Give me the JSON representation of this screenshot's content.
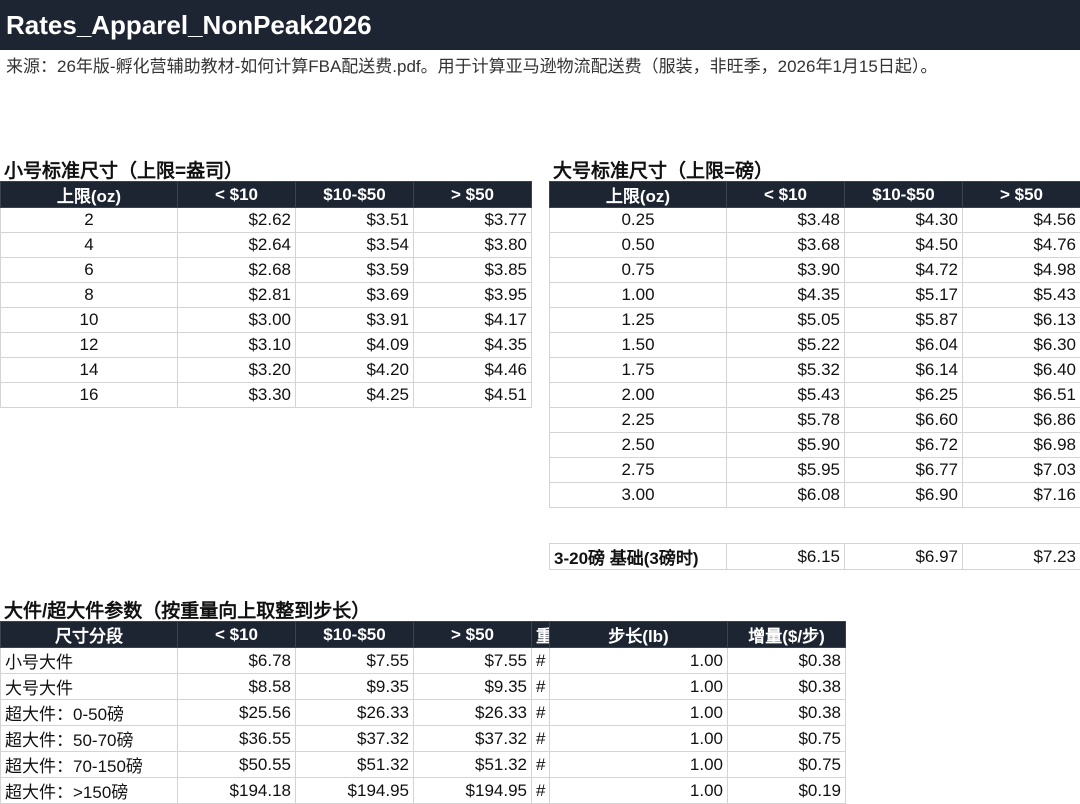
{
  "title": "Rates_Apparel_NonPeak2026",
  "source": "来源：26年版-孵化营辅助教材-如何计算FBA配送费.pdf。用于计算亚马逊物流配送费（服装，非旺季，2026年1月15日起）。",
  "small_standard": {
    "title": "小号标准尺寸（上限=盎司）",
    "headers": [
      "上限(oz)",
      "< $10",
      "$10-$50",
      "> $50"
    ],
    "rows": [
      [
        "2",
        "$2.62",
        "$3.51",
        "$3.77"
      ],
      [
        "4",
        "$2.64",
        "$3.54",
        "$3.80"
      ],
      [
        "6",
        "$2.68",
        "$3.59",
        "$3.85"
      ],
      [
        "8",
        "$2.81",
        "$3.69",
        "$3.95"
      ],
      [
        "10",
        "$3.00",
        "$3.91",
        "$4.17"
      ],
      [
        "12",
        "$3.10",
        "$4.09",
        "$4.35"
      ],
      [
        "14",
        "$3.20",
        "$4.20",
        "$4.46"
      ],
      [
        "16",
        "$3.30",
        "$4.25",
        "$4.51"
      ]
    ]
  },
  "large_standard": {
    "title": "大号标准尺寸（上限=磅）",
    "headers": [
      "上限(oz)",
      "< $10",
      "$10-$50",
      "> $50"
    ],
    "rows": [
      [
        "0.25",
        "$3.48",
        "$4.30",
        "$4.56"
      ],
      [
        "0.50",
        "$3.68",
        "$4.50",
        "$4.76"
      ],
      [
        "0.75",
        "$3.90",
        "$4.72",
        "$4.98"
      ],
      [
        "1.00",
        "$4.35",
        "$5.17",
        "$5.43"
      ],
      [
        "1.25",
        "$5.05",
        "$5.87",
        "$6.13"
      ],
      [
        "1.50",
        "$5.22",
        "$6.04",
        "$6.30"
      ],
      [
        "1.75",
        "$5.32",
        "$6.14",
        "$6.40"
      ],
      [
        "2.00",
        "$5.43",
        "$6.25",
        "$6.51"
      ],
      [
        "2.25",
        "$5.78",
        "$6.60",
        "$6.86"
      ],
      [
        "2.50",
        "$5.90",
        "$6.72",
        "$6.98"
      ],
      [
        "2.75",
        "$5.95",
        "$6.77",
        "$7.03"
      ],
      [
        "3.00",
        "$6.08",
        "$6.90",
        "$7.16"
      ]
    ],
    "base_row": [
      "3-20磅 基础(3磅时)",
      "$6.15",
      "$6.97",
      "$7.23"
    ]
  },
  "oversize": {
    "title": "大件/超大件参数（按重量向上取整到步长）",
    "headers": [
      "尺寸分段",
      "< $10",
      "$10-$50",
      "> $50",
      "重",
      "步长(lb)",
      "增量($/步)"
    ],
    "rows": [
      [
        "小号大件",
        "$6.78",
        "$7.55",
        "$7.55",
        "#",
        "1.00",
        "$0.38"
      ],
      [
        "大号大件",
        "$8.58",
        "$9.35",
        "$9.35",
        "#",
        "1.00",
        "$0.38"
      ],
      [
        "超大件：0-50磅",
        "$25.56",
        "$26.33",
        "$26.33",
        "#",
        "1.00",
        "$0.38"
      ],
      [
        "超大件：50-70磅",
        "$36.55",
        "$37.32",
        "$37.32",
        "#",
        "1.00",
        "$0.75"
      ],
      [
        "超大件：70-150磅",
        "$50.55",
        "$51.32",
        "$51.32",
        "#",
        "1.00",
        "$0.75"
      ],
      [
        "超大件：>150磅",
        "$194.18",
        "$194.95",
        "$194.95",
        "#",
        "1.00",
        "$0.19"
      ]
    ]
  }
}
